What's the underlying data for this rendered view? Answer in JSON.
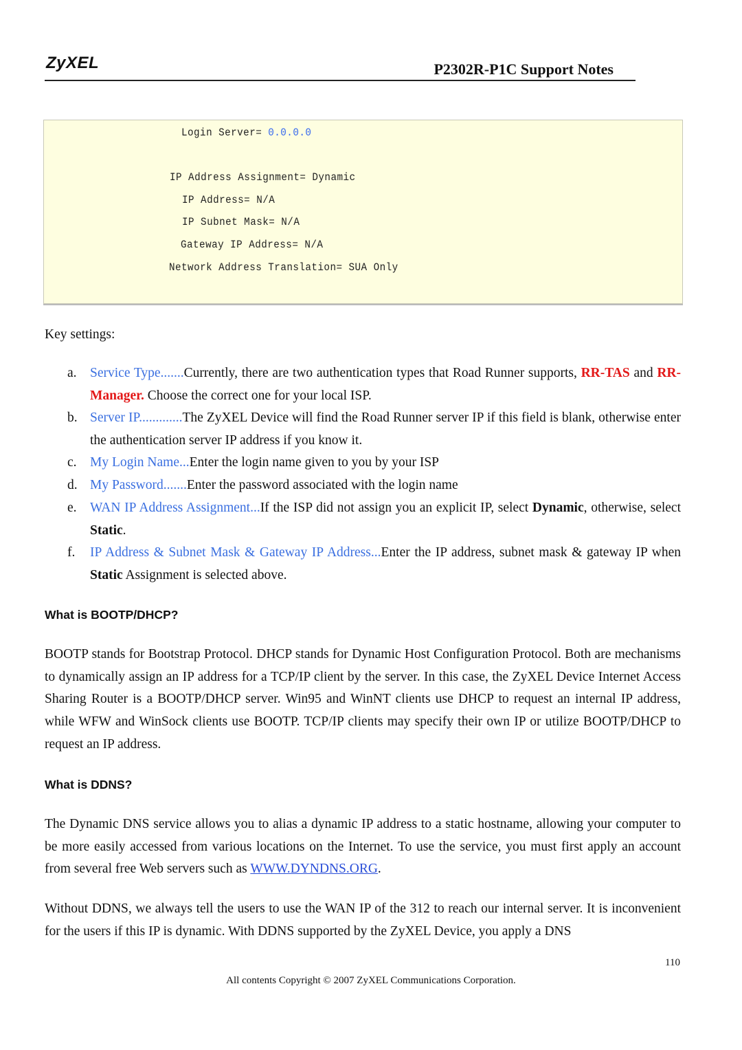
{
  "header": {
    "logo": "ZyXEL",
    "title": "P2302R-P1C Support Notes"
  },
  "config_box": {
    "login_server_label": "Login Server= ",
    "login_server_value": "0.0.0.0",
    "ip_assignment": "IP Address Assignment= Dynamic",
    "ip_address": "IP Address= N/A",
    "subnet_mask": "IP Subnet Mask= N/A",
    "gateway": "Gateway IP Address= N/A",
    "nat": "Network Address Translation= SUA Only"
  },
  "key_settings": {
    "heading": "Key settings:",
    "items": [
      {
        "marker": "a.",
        "term": "Service Type.......",
        "text1": "Currently, there are two authentication types that Road Runner supports, ",
        "red1": "RR-TAS",
        "text2": " and ",
        "red2": "RR-Manager.",
        "text3": " Choose the correct one for your local ISP."
      },
      {
        "marker": "b.",
        "term": "Server IP.............",
        "text": "The ZyXEL Device will find the Road Runner server IP if this field is blank, otherwise enter the authentication server IP address if you know it."
      },
      {
        "marker": "c.",
        "term": "My Login Name...",
        "text": "Enter the login name given to you by your ISP"
      },
      {
        "marker": "d.",
        "term": "My Password.......",
        "text": "Enter the password associated with the login name"
      },
      {
        "marker": "e.",
        "term": "WAN IP Address Assignment...",
        "text1": "If the ISP did not assign you an explicit IP, select ",
        "bold1": "Dynamic",
        "text2": ", otherwise, select ",
        "bold2": "Static",
        "text3": "."
      },
      {
        "marker": "f.",
        "term": "IP Address & Subnet Mask & Gateway IP Address...",
        "text1": "Enter the IP address, subnet mask & gateway IP when ",
        "bold1": "Static",
        "text2": " Assignment is selected above."
      }
    ]
  },
  "bootp": {
    "heading": "What is BOOTP/DHCP?",
    "body": "BOOTP stands for Bootstrap Protocol. DHCP stands for Dynamic Host Configuration Protocol. Both are mechanisms to dynamically assign an IP address for a TCP/IP client by the server. In this case, the ZyXEL Device Internet Access Sharing Router is a BOOTP/DHCP server. Win95 and WinNT clients use DHCP to request an internal IP address, while WFW and WinSock clients use BOOTP. TCP/IP clients may specify their own IP or utilize BOOTP/DHCP to request an IP address."
  },
  "ddns": {
    "heading": "What is DDNS?",
    "body1_pre": "The Dynamic DNS service allows you to alias a dynamic IP address to a static hostname, allowing your computer to be more easily accessed from various locations on the Internet. To use the service, you must first apply an account from several free Web servers such as ",
    "body1_link": "WWW.DYNDNS.ORG",
    "body1_post": ".",
    "body2": "Without DDNS, we always tell the users to use the WAN IP of the 312 to reach our internal server. It is inconvenient for the users if this IP is dynamic. With DDNS supported by the ZyXEL Device, you apply a DNS"
  },
  "footer": {
    "page_number": "110",
    "copyright": "All contents Copyright © 2007 ZyXEL Communications Corporation."
  }
}
